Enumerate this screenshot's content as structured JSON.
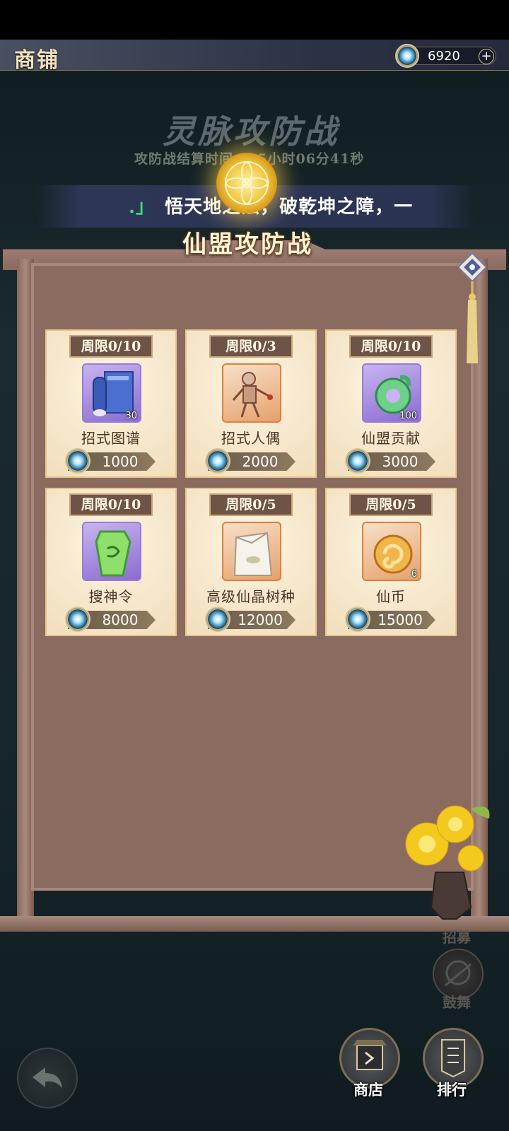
{
  "header": {
    "title": "商铺",
    "currency_value": "6920",
    "plus_label": "+"
  },
  "banner": {
    "event_title": "灵脉攻防战",
    "timer_text": "攻防战结算时间：05小时06分41秒",
    "ribbon_text": "悟天地之法，破乾坤之障，一",
    "board_title": "仙盟攻防战"
  },
  "shop_items": [
    {
      "limit": "周限0/10",
      "name": "招式图谱",
      "qty": "30",
      "price": "1000",
      "icon": "scroll-icon",
      "rarity": "purple"
    },
    {
      "limit": "周限0/3",
      "name": "招式人偶",
      "qty": "",
      "price": "2000",
      "icon": "puppet-icon",
      "rarity": "orange"
    },
    {
      "limit": "周限0/10",
      "name": "仙盟贡献",
      "qty": "100",
      "price": "3000",
      "icon": "jade-dragon-icon",
      "rarity": "purple"
    },
    {
      "limit": "周限0/10",
      "name": "搜神令",
      "qty": "",
      "price": "8000",
      "icon": "green-token-icon",
      "rarity": "purple"
    },
    {
      "limit": "周限0/5",
      "name": "高级仙晶树种",
      "qty": "",
      "price": "12000",
      "icon": "seed-bag-icon",
      "rarity": "orange"
    },
    {
      "limit": "周限0/5",
      "name": "仙币",
      "qty": "6",
      "price": "15000",
      "icon": "gold-coin-icon",
      "rarity": "orange"
    }
  ],
  "side": {
    "recruit_label": "招募",
    "drum_label": "鼓舞"
  },
  "bottom_nav": {
    "shop_label": "商店",
    "rank_label": "排行"
  },
  "colors": {
    "card_bg": "#f8ead0",
    "board_bg": "#8b6b60",
    "badge_bg": "#6e5347",
    "ribbon_bg": "#2d3656"
  }
}
